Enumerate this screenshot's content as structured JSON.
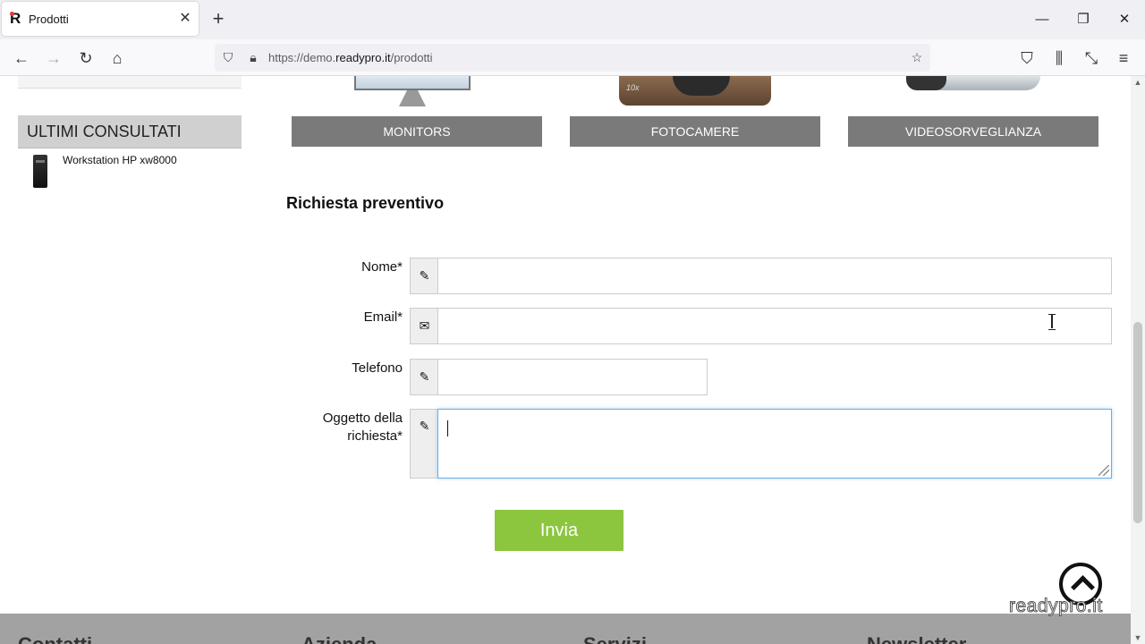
{
  "browser": {
    "tab_title": "Prodotti",
    "tab_favicon": "R",
    "url_prefix": "https://demo.",
    "url_domain": "readypro.it",
    "url_path": "/prodotti"
  },
  "sidebar": {
    "heading": "ULTIMI CONSULTATI",
    "recent": [
      {
        "label": "Workstation HP xw8000"
      }
    ]
  },
  "categories": [
    {
      "label": "MONITORS",
      "image_text": ""
    },
    {
      "label": "FOTOCAMERE",
      "image_text": "10x"
    },
    {
      "label": "VIDEOSORVEGLIANZA",
      "image_text": ""
    }
  ],
  "form": {
    "title": "Richiesta preventivo",
    "fields": [
      {
        "label": "Nome*",
        "icon": "pencil-icon",
        "value": ""
      },
      {
        "label": "Email*",
        "icon": "envelope-icon",
        "value": ""
      },
      {
        "label": "Telefono",
        "icon": "pencil-icon",
        "value": ""
      },
      {
        "label_line1": "Oggetto della",
        "label_line2": "richiesta*",
        "icon": "pencil-icon",
        "value": ""
      }
    ],
    "submit_label": "Invia"
  },
  "watermark": "readypro.it",
  "footer_headings": [
    "Contatti",
    "Azienda",
    "Servizi",
    "Newsletter"
  ],
  "colors": {
    "submit_green": "#8cc63f",
    "category_button_gray": "#7a7a7a",
    "sidebar_heading_gray": "#d0d0d0",
    "footer_gray": "#a2a2a2"
  }
}
